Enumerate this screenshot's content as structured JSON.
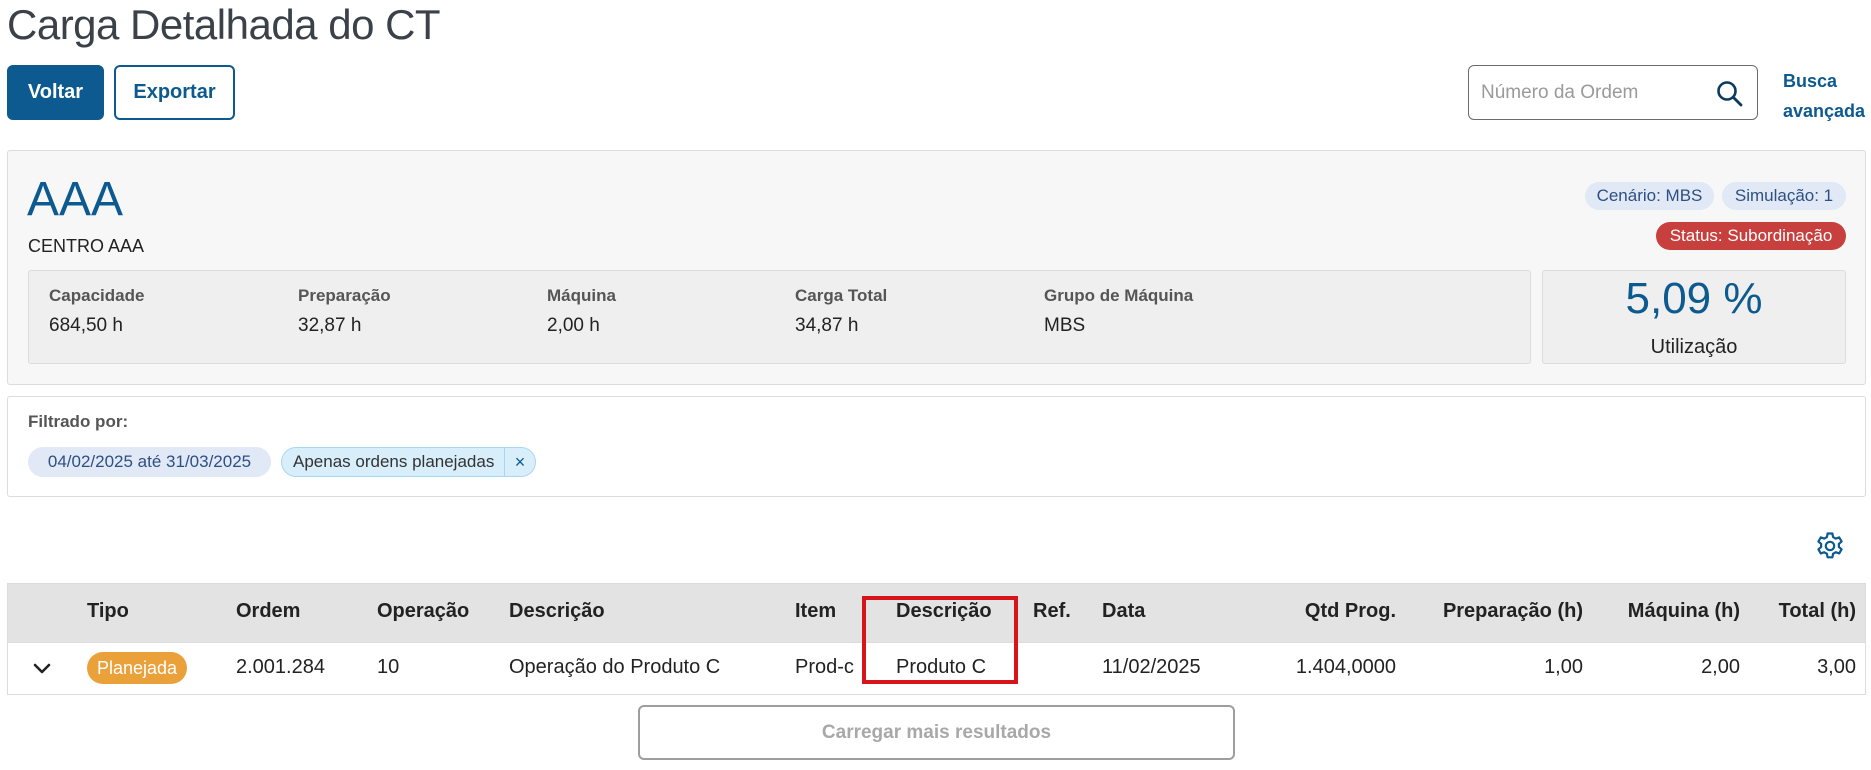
{
  "header": {
    "title": "Carga Detalhada do CT",
    "back_label": "Voltar",
    "export_label": "Exportar",
    "search_placeholder": "Número da Ordem",
    "advanced_search_line1": "Busca",
    "advanced_search_line2": "avançada"
  },
  "ct": {
    "code": "AAA",
    "name": "CENTRO AAA",
    "scenario": "Cenário: MBS",
    "simulation": "Simulação: 1",
    "status": "Status: Subordinação",
    "stats": [
      {
        "label": "Capacidade",
        "value": "684,50 h"
      },
      {
        "label": "Preparação",
        "value": "32,87 h"
      },
      {
        "label": "Máquina",
        "value": "2,00 h"
      },
      {
        "label": "Carga Total",
        "value": "34,87 h"
      },
      {
        "label": "Grupo de Máquina",
        "value": "MBS"
      }
    ],
    "utilization_value": "5,09 %",
    "utilization_label": "Utilização"
  },
  "filters": {
    "label": "Filtrado por:",
    "date_range": "04/02/2025 até 31/03/2025",
    "planned_only": "Apenas ordens planejadas",
    "remove_symbol": "×"
  },
  "table": {
    "columns": [
      "Tipo",
      "Ordem",
      "Operação",
      "Descrição",
      "Item",
      "Descrição",
      "Ref.",
      "Data",
      "Qtd Prog.",
      "Preparação (h)",
      "Máquina (h)",
      "Total (h)"
    ],
    "rows": [
      {
        "tipo": "Planejada",
        "ordem": "2.001.284",
        "operacao": "10",
        "descricao": "Operação do Produto C",
        "item": "Prod-c",
        "item_descricao": "Produto C",
        "ref": "",
        "data": "11/02/2025",
        "qtd_prog": "1.404,0000",
        "preparacao": "1,00",
        "maquina": "2,00",
        "total": "3,00"
      }
    ]
  },
  "load_more_label": "Carregar mais resultados",
  "colors": {
    "primary": "#0c5a8f",
    "status_red": "#c7403d",
    "planned_orange": "#eba13a",
    "highlight_red": "#d7141a"
  },
  "icons": {
    "search": "search-icon",
    "settings": "gear-icon",
    "expand": "chevron-down-icon",
    "remove": "close-icon"
  }
}
